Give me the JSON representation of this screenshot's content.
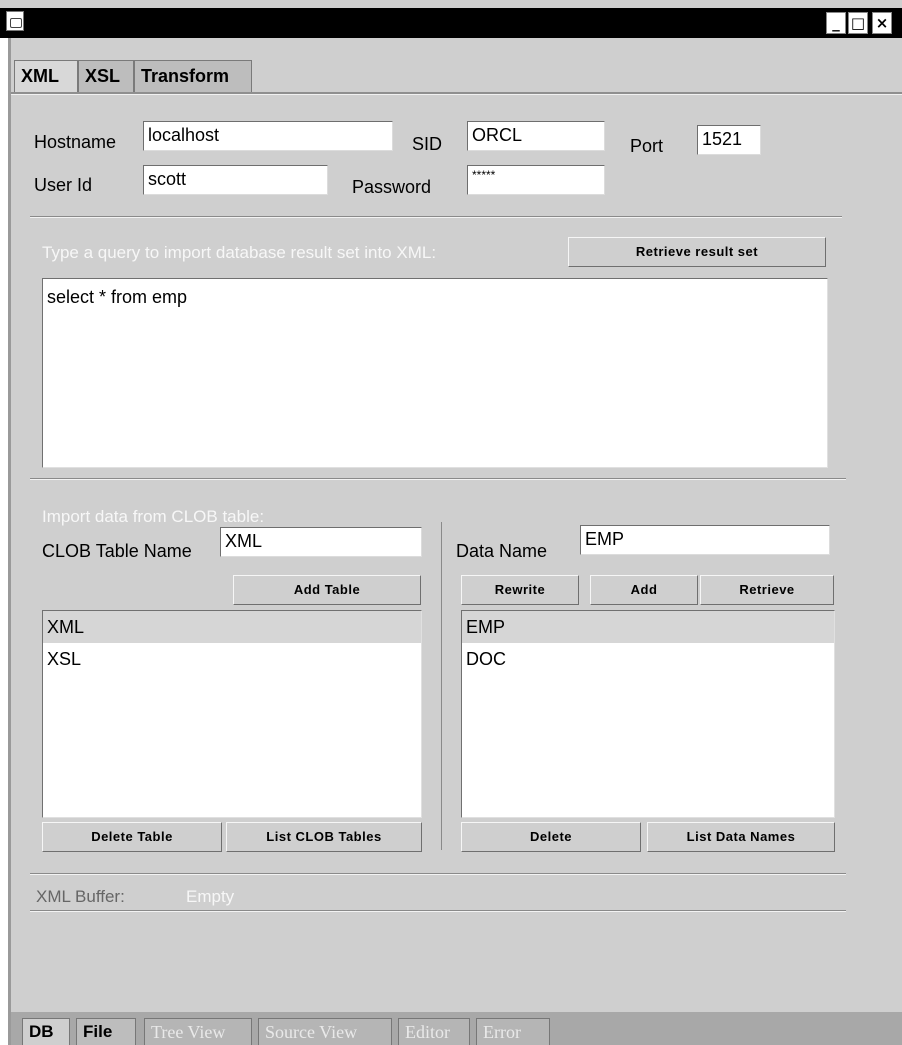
{
  "window": {
    "minimize_glyph": "_",
    "maximize_glyph": "□",
    "close_glyph": "×"
  },
  "top_tabs": [
    {
      "label": "XML"
    },
    {
      "label": "XSL"
    },
    {
      "label": "Transform"
    }
  ],
  "connection": {
    "hostname_label": "Hostname",
    "hostname_value": "localhost",
    "sid_label": "SID",
    "sid_value": "ORCL",
    "port_label": "Port",
    "port_value": "1521",
    "userid_label": "User Id",
    "userid_value": "scott",
    "password_label": "Password",
    "password_value": "*****"
  },
  "query": {
    "prompt": "Type a query to import database result set into XML:",
    "retrieve_button": "Retrieve result set",
    "text": "select * from emp"
  },
  "clob": {
    "section_label": "Import data from CLOB table:",
    "table_name_label": "CLOB Table Name",
    "table_name_value": "XML",
    "add_table_button": "Add Table",
    "tables": [
      "XML",
      "XSL"
    ],
    "delete_table_button": "Delete Table",
    "list_tables_button": "List CLOB Tables"
  },
  "data": {
    "data_name_label": "Data Name",
    "data_name_value": "EMP",
    "rewrite_button": "Rewrite",
    "add_button": "Add",
    "retrieve_button": "Retrieve",
    "names": [
      "EMP",
      "DOC"
    ],
    "delete_button": "Delete",
    "list_names_button": "List Data Names"
  },
  "buffer": {
    "label": "XML Buffer:",
    "status": "Empty"
  },
  "bottom_tabs": [
    {
      "label": "DB"
    },
    {
      "label": "File"
    },
    {
      "label": "Tree View"
    },
    {
      "label": "Source View"
    },
    {
      "label": "Editor"
    },
    {
      "label": "Error"
    }
  ]
}
